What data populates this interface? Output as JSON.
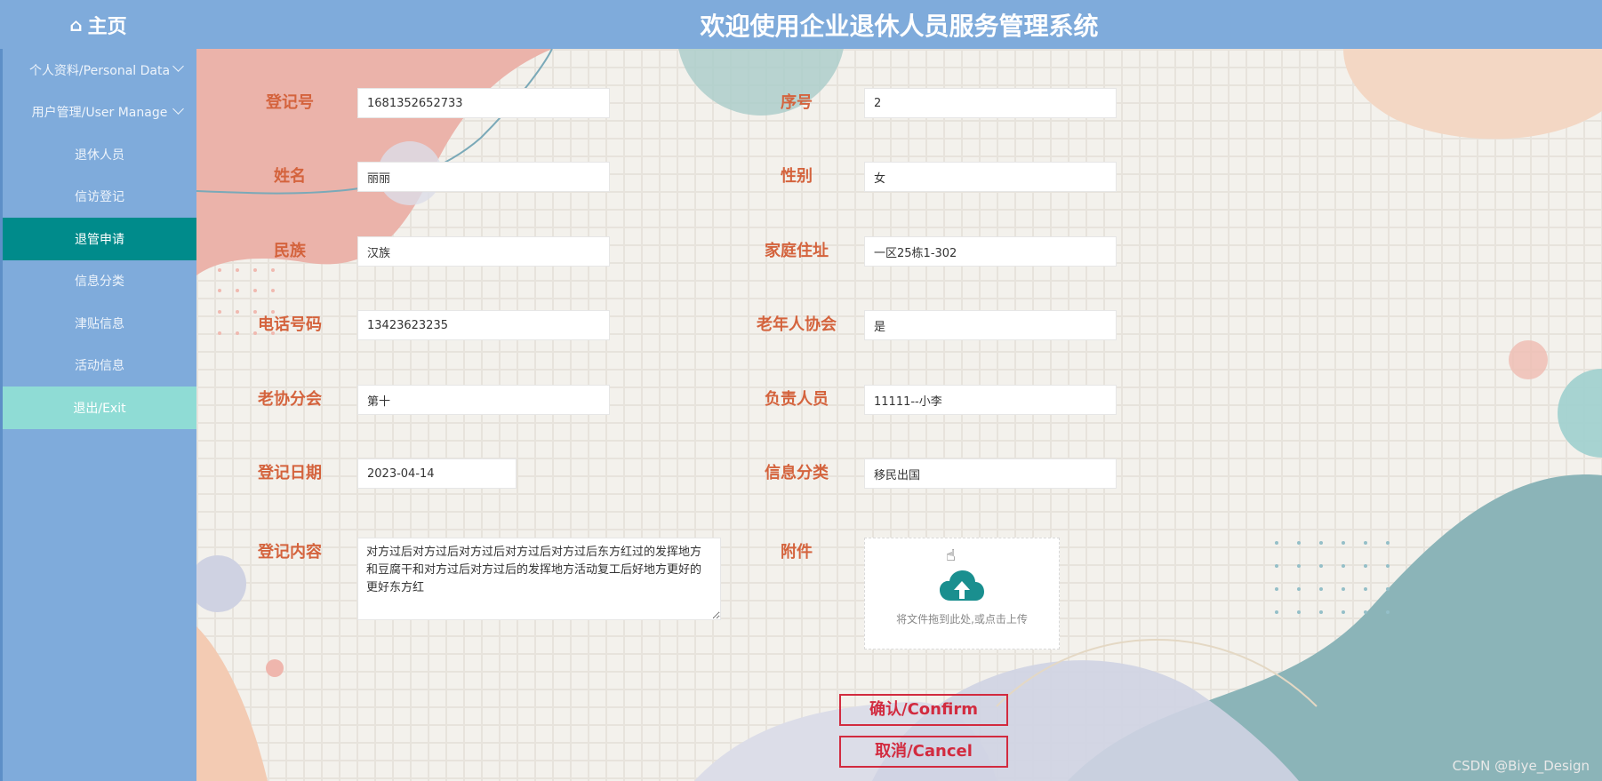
{
  "header": {
    "home_label": "主页",
    "title": "欢迎使用企业退休人员服务管理系统"
  },
  "sidebar": {
    "items": [
      {
        "label": "个人资料/Personal Data",
        "has_chevron": true
      },
      {
        "label": "用户管理/User Manage",
        "has_chevron": true
      },
      {
        "label": "退休人员"
      },
      {
        "label": "信访登记"
      },
      {
        "label": "退管申请",
        "active": true
      },
      {
        "label": "信息分类"
      },
      {
        "label": "津贴信息"
      },
      {
        "label": "活动信息"
      },
      {
        "label": "退出/Exit"
      }
    ]
  },
  "form": {
    "registration_no": {
      "label": "登记号",
      "value": "1681352652733"
    },
    "serial_no": {
      "label": "序号",
      "value": "2"
    },
    "name": {
      "label": "姓名",
      "value": "丽丽"
    },
    "gender": {
      "label": "性别",
      "value": "女"
    },
    "ethnicity": {
      "label": "民族",
      "value": "汉族"
    },
    "address": {
      "label": "家庭住址",
      "value": "一区25栋1-302"
    },
    "phone": {
      "label": "电话号码",
      "value": "13423623235"
    },
    "elderly_association": {
      "label": "老年人协会",
      "value": "是"
    },
    "branch": {
      "label": "老协分会",
      "value": "第十"
    },
    "person_in_charge": {
      "label": "负责人员",
      "value": "11111--小李"
    },
    "reg_date": {
      "label": "登记日期",
      "value": "2023-04-14"
    },
    "category": {
      "label": "信息分类",
      "value": "移民出国"
    },
    "content": {
      "label": "登记内容",
      "value": "对方过后对方过后对方过后对方过后对方过后东方红过的发挥地方和豆腐干和对方过后对方过后的发挥地方活动复工后好地方更好的更好东方红"
    },
    "attachment": {
      "label": "附件",
      "hint": "将文件拖到此处,或点击上传"
    }
  },
  "buttons": {
    "confirm": "确认/Confirm",
    "cancel": "取消/Cancel"
  },
  "watermark": "CSDN @Biye_Design",
  "colors": {
    "sidebar": "#7fabdb",
    "active": "#008b8b",
    "exit": "#8fdcd5",
    "label": "#d4633d",
    "button": "#d22b3f"
  }
}
